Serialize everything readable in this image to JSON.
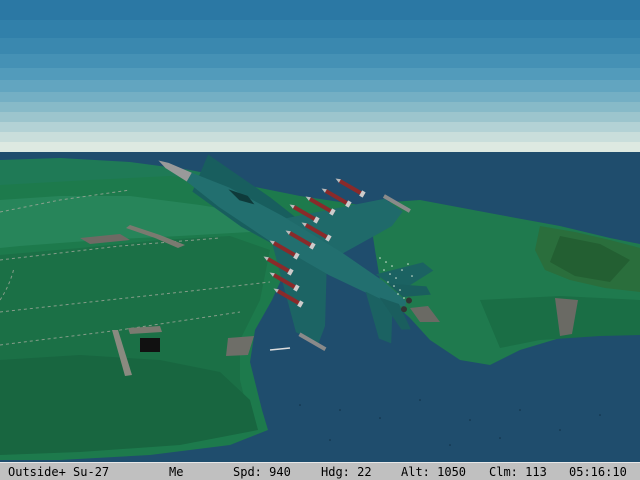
{
  "status_bar": {
    "view_mode": "Outside+ Su-27",
    "pilot": "Me",
    "speed": "Spd: 940",
    "heading": "Hdg: 22",
    "altitude": "Alt: 1050",
    "climb": "Clm: 113",
    "clock": "05:16:10"
  },
  "scene": {
    "aircraft": "Su-27",
    "aircraft_color": "#1f6a6a",
    "sky_top_color": "#2c7ba6",
    "horizon_color": "#dfe8e0",
    "sea_color": "#1f4e6e",
    "land_color": "#1f7a4e",
    "missile_count": 10
  }
}
